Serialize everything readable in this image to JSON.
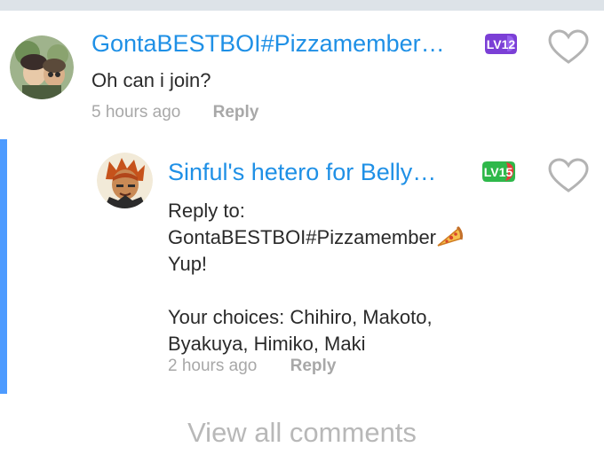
{
  "comments": [
    {
      "username": "GontaBESTBOI#Pizzamember…",
      "level": "LV12",
      "text": "Oh can i join?",
      "time": "5 hours ago",
      "reply_label": "Reply"
    },
    {
      "username": "Sinful's hetero for Belly…",
      "level": "LV15",
      "reply_to_label": "Reply to:",
      "reply_to_user": "GontaBESTBOI#Pizzamember",
      "line1": "Yup!",
      "line2": "Your choices: Chihiro, Makoto,",
      "line3": "Byakuya, Himiko, Maki",
      "time": "2 hours ago",
      "reply_label": "Reply"
    }
  ],
  "colors": {
    "username": "#1f90e6",
    "lv12_badge": "#7b3fd6",
    "lv15_badge": "#2eb84a",
    "reply_rail": "#4d9bff"
  },
  "icons": [
    "heart-outline-icon",
    "pizza-icon",
    "level-badge"
  ],
  "footer": {
    "view_all": "View all comments"
  }
}
